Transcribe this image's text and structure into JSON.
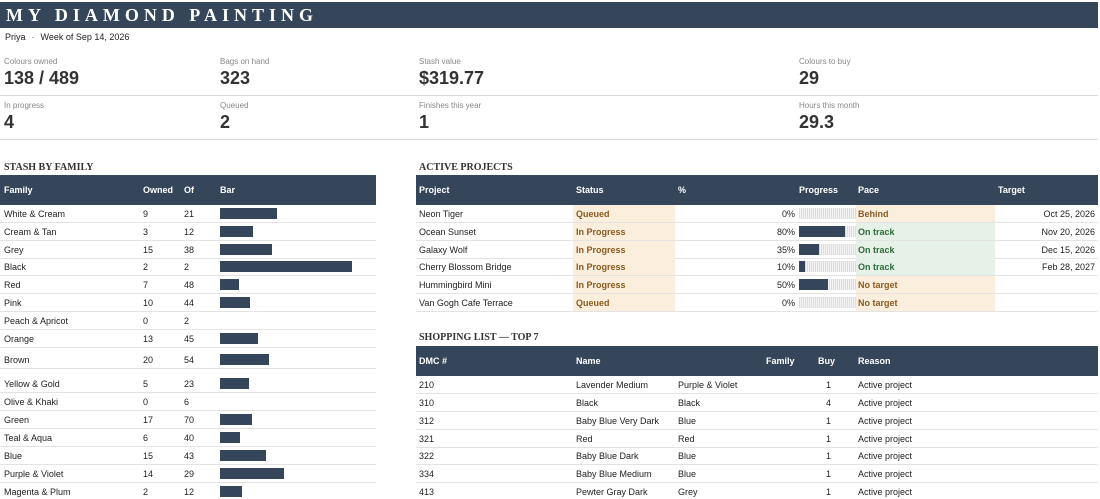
{
  "title": "MY DIAMOND PAINTING",
  "user": "Priya",
  "separator": "·",
  "week": "Week of Sep 14, 2026",
  "kpis": {
    "colours_owned": {
      "label": "Colours owned",
      "value": "138 / 489"
    },
    "bags_on_hand": {
      "label": "Bags on hand",
      "value": "323"
    },
    "stash_value": {
      "label": "Stash value",
      "value": "$319.77"
    },
    "colours_to_buy": {
      "label": "Colours to buy",
      "value": "29"
    },
    "in_progress": {
      "label": "In progress",
      "value": "4"
    },
    "queued": {
      "label": "Queued",
      "value": "2"
    },
    "finishes": {
      "label": "Finishes this year",
      "value": "1"
    },
    "hours": {
      "label": "Hours this month",
      "value": "29.3"
    }
  },
  "stash": {
    "heading": "STASH BY FAMILY",
    "columns": {
      "family": "Family",
      "owned": "Owned",
      "of": "Of",
      "bar": "Bar"
    },
    "rows": [
      {
        "family": "White & Cream",
        "owned": "9",
        "of": "21",
        "ratio": 0.4286
      },
      {
        "family": "Cream & Tan",
        "owned": "3",
        "of": "12",
        "ratio": 0.25
      },
      {
        "family": "Grey",
        "owned": "15",
        "of": "38",
        "ratio": 0.3947
      },
      {
        "family": "Black",
        "owned": "2",
        "of": "2",
        "ratio": 1.0
      },
      {
        "family": "Red",
        "owned": "7",
        "of": "48",
        "ratio": 0.1458
      },
      {
        "family": "Pink",
        "owned": "10",
        "of": "44",
        "ratio": 0.2273
      },
      {
        "family": "Peach & Apricot",
        "owned": "0",
        "of": "2",
        "ratio": 0
      },
      {
        "family": "Orange",
        "owned": "13",
        "of": "45",
        "ratio": 0.2889
      },
      {
        "family": "Brown",
        "owned": "20",
        "of": "54",
        "ratio": 0.3704
      },
      {
        "family": "Yellow & Gold",
        "owned": "5",
        "of": "23",
        "ratio": 0.2174
      },
      {
        "family": "Olive & Khaki",
        "owned": "0",
        "of": "6",
        "ratio": 0
      },
      {
        "family": "Green",
        "owned": "17",
        "of": "70",
        "ratio": 0.2429
      },
      {
        "family": "Teal & Aqua",
        "owned": "6",
        "of": "40",
        "ratio": 0.15
      },
      {
        "family": "Blue",
        "owned": "15",
        "of": "43",
        "ratio": 0.3488
      },
      {
        "family": "Purple & Violet",
        "owned": "14",
        "of": "29",
        "ratio": 0.4828
      },
      {
        "family": "Magenta & Plum",
        "owned": "2",
        "of": "12",
        "ratio": 0.1667
      }
    ]
  },
  "projects": {
    "heading": "ACTIVE PROJECTS",
    "columns": {
      "project": "Project",
      "status": "Status",
      "pct": "%",
      "progress": "Progress",
      "pace": "Pace",
      "target": "Target"
    },
    "rows": [
      {
        "project": "Neon Tiger",
        "status": "Queued",
        "pct": "0%",
        "progress": 0.0,
        "pace": "Behind",
        "pace_kind": "behind",
        "target": "Oct 25, 2026"
      },
      {
        "project": "Ocean Sunset",
        "status": "In Progress",
        "pct": "80%",
        "progress": 0.8,
        "pace": "On track",
        "pace_kind": "ok",
        "target": "Nov 20, 2026"
      },
      {
        "project": "Galaxy Wolf",
        "status": "In Progress",
        "pct": "35%",
        "progress": 0.35,
        "pace": "On track",
        "pace_kind": "ok",
        "target": "Dec 15, 2026"
      },
      {
        "project": "Cherry Blossom Bridge",
        "status": "In Progress",
        "pct": "10%",
        "progress": 0.1,
        "pace": "On track",
        "pace_kind": "ok",
        "target": "Feb 28, 2027"
      },
      {
        "project": "Hummingbird Mini",
        "status": "In Progress",
        "pct": "50%",
        "progress": 0.5,
        "pace": "No target",
        "pace_kind": "behind",
        "target": ""
      },
      {
        "project": "Van Gogh Cafe Terrace",
        "status": "Queued",
        "pct": "0%",
        "progress": 0.0,
        "pace": "No target",
        "pace_kind": "behind",
        "target": ""
      }
    ]
  },
  "shopping": {
    "heading": "SHOPPING LIST — TOP 7",
    "columns": {
      "dmc": "DMC #",
      "name": "Name",
      "family": "Family",
      "buy": "Buy",
      "reason": "Reason"
    },
    "rows": [
      {
        "dmc": "210",
        "name": "Lavender Medium",
        "family": "Purple & Violet",
        "buy": "1",
        "reason": "Active project"
      },
      {
        "dmc": "310",
        "name": "Black",
        "family": "Black",
        "buy": "4",
        "reason": "Active project"
      },
      {
        "dmc": "312",
        "name": "Baby Blue Very Dark",
        "family": "Blue",
        "buy": "1",
        "reason": "Active project"
      },
      {
        "dmc": "321",
        "name": "Red",
        "family": "Red",
        "buy": "1",
        "reason": "Active project"
      },
      {
        "dmc": "322",
        "name": "Baby Blue Dark",
        "family": "Blue",
        "buy": "1",
        "reason": "Active project"
      },
      {
        "dmc": "334",
        "name": "Baby Blue Medium",
        "family": "Blue",
        "buy": "1",
        "reason": "Active project"
      },
      {
        "dmc": "413",
        "name": "Pewter Gray Dark",
        "family": "Grey",
        "buy": "1",
        "reason": "Active project"
      }
    ]
  },
  "colors": {
    "header": "#36465a",
    "status_bg": "#fbeedd",
    "pace_ok_bg": "#e6f1e7",
    "pace_warn_bg": "#fbeedd",
    "bar": "#36465a"
  }
}
